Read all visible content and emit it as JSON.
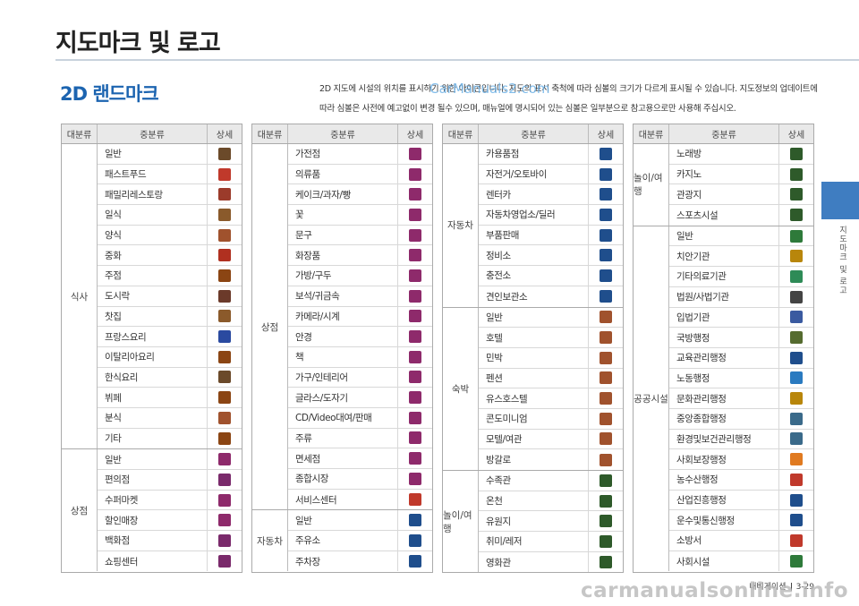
{
  "page_title": "지도마크 및 로고",
  "section_title": "2D 랜드마크",
  "intro": "2D 지도에 시설의 위치를 표시하기 위한 아이콘입니다. 지도의 표시 축척에 따라 심볼의 크기가 다르게 표시될 수 있습니다. 지도정보의 업데이트에 따라 심볼은 사전에 예고없이 변경 될수 있으며, 매뉴얼에 명시되어 있는 심볼은 일부분으로 참고용으로만 사용해 주십시오.",
  "watermark_top": "CarManuals2.com",
  "watermark_bottom": "carmanualsonline.info",
  "side_label": "지도마크 및 로고",
  "footer": {
    "left": "내비게이션",
    "right": "3-29"
  },
  "header": {
    "cat": "대분류",
    "sub": "중분류",
    "detail": "상세"
  },
  "tables": [
    {
      "groups": [
        {
          "name": "식사",
          "items": [
            {
              "label": "일반",
              "icon": "fork-knife-icon",
              "color": "#6b4a2a"
            },
            {
              "label": "패스트푸드",
              "icon": "fastfood-icon",
              "color": "#c0392b"
            },
            {
              "label": "패밀리레스토랑",
              "icon": "family-restaurant-icon",
              "color": "#9b3b2b"
            },
            {
              "label": "일식",
              "icon": "chopsticks-icon",
              "color": "#8a5a2b"
            },
            {
              "label": "양식",
              "icon": "plate-icon",
              "color": "#a0522d"
            },
            {
              "label": "중화",
              "icon": "chinese-icon",
              "color": "#b03020"
            },
            {
              "label": "주점",
              "icon": "beer-icon",
              "color": "#8b4513"
            },
            {
              "label": "도시락",
              "icon": "lunchbox-icon",
              "color": "#6b3a2a"
            },
            {
              "label": "찻집",
              "icon": "teacup-icon",
              "color": "#8b5a2b"
            },
            {
              "label": "프랑스요리",
              "icon": "france-flag-icon",
              "color": "#2a4aa0"
            },
            {
              "label": "이탈리아요리",
              "icon": "italy-icon",
              "color": "#8b4513"
            },
            {
              "label": "한식요리",
              "icon": "spoon-chopsticks-icon",
              "color": "#6b4a2a"
            },
            {
              "label": "뷔페",
              "icon": "buffet-icon",
              "color": "#8b4513"
            },
            {
              "label": "분식",
              "icon": "snack-icon",
              "color": "#a0522d"
            },
            {
              "label": "기타",
              "icon": "other-food-icon",
              "color": "#8b4513"
            }
          ]
        },
        {
          "name": "상점",
          "items": [
            {
              "label": "일반",
              "icon": "gift-icon",
              "color": "#8e2a6b"
            },
            {
              "label": "편의점",
              "icon": "convenience-store-icon",
              "color": "#7a2a6b"
            },
            {
              "label": "수퍼마켓",
              "icon": "basket-icon",
              "color": "#8e2a6b"
            },
            {
              "label": "할인매장",
              "icon": "sale-cart-icon",
              "color": "#8e2a6b"
            },
            {
              "label": "백화점",
              "icon": "department-store-icon",
              "color": "#7a2a6b"
            },
            {
              "label": "쇼핑센터",
              "icon": "shopping-center-icon",
              "color": "#7a2a6b"
            }
          ]
        }
      ]
    },
    {
      "groups": [
        {
          "name": "상점",
          "items": [
            {
              "label": "가전점",
              "icon": "tv-icon",
              "color": "#8e2a6b"
            },
            {
              "label": "의류품",
              "icon": "shirt-icon",
              "color": "#8e2a6b"
            },
            {
              "label": "케이크/과자/빵",
              "icon": "bread-icon",
              "color": "#8e2a6b"
            },
            {
              "label": "꽃",
              "icon": "flower-icon",
              "color": "#8e2a6b"
            },
            {
              "label": "문구",
              "icon": "stationery-icon",
              "color": "#8e2a6b"
            },
            {
              "label": "화장품",
              "icon": "cosmetics-icon",
              "color": "#8e2a6b"
            },
            {
              "label": "가방/구두",
              "icon": "bag-icon",
              "color": "#8e2a6b"
            },
            {
              "label": "보석/귀금속",
              "icon": "diamond-icon",
              "color": "#8e2a6b"
            },
            {
              "label": "카메라/시계",
              "icon": "camera-icon",
              "color": "#8e2a6b"
            },
            {
              "label": "안경",
              "icon": "glasses-icon",
              "color": "#8e2a6b"
            },
            {
              "label": "책",
              "icon": "book-icon",
              "color": "#8e2a6b"
            },
            {
              "label": "가구/인테리어",
              "icon": "lamp-icon",
              "color": "#8e2a6b"
            },
            {
              "label": "글라스/도자기",
              "icon": "vase-icon",
              "color": "#8e2a6b"
            },
            {
              "label": "CD/Video대여/판매",
              "icon": "disc-icon",
              "color": "#8e2a6b"
            },
            {
              "label": "주류",
              "icon": "bottles-icon",
              "color": "#8e2a6b"
            },
            {
              "label": "면세점",
              "icon": "duty-free-icon",
              "color": "#8e2a6b"
            },
            {
              "label": "종합시장",
              "icon": "market-icon",
              "color": "#8e2a6b"
            },
            {
              "label": "서비스센터",
              "icon": "service-center-icon",
              "color": "#c0392b"
            }
          ]
        },
        {
          "name": "자동차",
          "items": [
            {
              "label": "일반",
              "icon": "car-icon",
              "color": "#1f4e8c"
            },
            {
              "label": "주유소",
              "icon": "gas-station-icon",
              "color": "#1f4e8c"
            },
            {
              "label": "주차장",
              "icon": "parking-icon",
              "color": "#1f4e8c"
            }
          ]
        }
      ]
    },
    {
      "groups": [
        {
          "name": "자동차",
          "items": [
            {
              "label": "카용품점",
              "icon": "tire-icon",
              "color": "#1f4e8c"
            },
            {
              "label": "자전거/오토바이",
              "icon": "bicycle-icon",
              "color": "#1f4e8c"
            },
            {
              "label": "렌터카",
              "icon": "rental-car-icon",
              "color": "#1f4e8c"
            },
            {
              "label": "자동차영업소/딜러",
              "icon": "car-shop-icon",
              "color": "#1f4e8c"
            },
            {
              "label": "부품판매",
              "icon": "parts-icon",
              "color": "#1f4e8c"
            },
            {
              "label": "정비소",
              "icon": "repair-icon",
              "color": "#1f4e8c"
            },
            {
              "label": "충전소",
              "icon": "charging-icon",
              "color": "#1f4e8c"
            },
            {
              "label": "견인보관소",
              "icon": "tow-icon",
              "color": "#1f4e8c"
            }
          ]
        },
        {
          "name": "숙박",
          "items": [
            {
              "label": "일반",
              "icon": "hotel-general-icon",
              "color": "#a0522d"
            },
            {
              "label": "호텔",
              "icon": "hotel-icon",
              "color": "#a0522d"
            },
            {
              "label": "민박",
              "icon": "guesthouse-icon",
              "color": "#a0522d"
            },
            {
              "label": "펜션",
              "icon": "pension-icon",
              "color": "#a0522d"
            },
            {
              "label": "유스호스텔",
              "icon": "hostel-icon",
              "color": "#a0522d"
            },
            {
              "label": "콘도미니엄",
              "icon": "condo-icon",
              "color": "#a0522d"
            },
            {
              "label": "모텔/여관",
              "icon": "motel-icon",
              "color": "#a0522d"
            },
            {
              "label": "방갈로",
              "icon": "bungalow-icon",
              "color": "#a0522d"
            }
          ]
        },
        {
          "name": "놀이/여행",
          "items": [
            {
              "label": "수족관",
              "icon": "fish-icon",
              "color": "#2e5a2a"
            },
            {
              "label": "온천",
              "icon": "hot-spring-icon",
              "color": "#2e5a2a"
            },
            {
              "label": "유원지",
              "icon": "amusement-icon",
              "color": "#2e5a2a"
            },
            {
              "label": "취미/레저",
              "icon": "leisure-icon",
              "color": "#2e5a2a"
            },
            {
              "label": "영화관",
              "icon": "cinema-icon",
              "color": "#2e5a2a"
            }
          ]
        }
      ]
    },
    {
      "groups": [
        {
          "name": "놀이/여행",
          "items": [
            {
              "label": "노래방",
              "icon": "karaoke-icon",
              "color": "#2e5a2a"
            },
            {
              "label": "카지노",
              "icon": "casino-icon",
              "color": "#2e5a2a"
            },
            {
              "label": "관광지",
              "icon": "tourist-icon",
              "color": "#2e5a2a"
            },
            {
              "label": "스포츠시설",
              "icon": "sports-icon",
              "color": "#2e5a2a"
            }
          ]
        },
        {
          "name": "공공시설",
          "items": [
            {
              "label": "일반",
              "icon": "public-building-icon",
              "color": "#2e7a3a"
            },
            {
              "label": "치안기관",
              "icon": "police-icon",
              "color": "#b8860b"
            },
            {
              "label": "기타의료기관",
              "icon": "medical-icon",
              "color": "#2e8b57"
            },
            {
              "label": "법원/사법기관",
              "icon": "scales-icon",
              "color": "#444444"
            },
            {
              "label": "입법기관",
              "icon": "assembly-icon",
              "color": "#3a5aa0"
            },
            {
              "label": "국방행정",
              "icon": "defense-icon",
              "color": "#556b2f"
            },
            {
              "label": "교육관리행정",
              "icon": "education-icon",
              "color": "#1f4e8c"
            },
            {
              "label": "노동행정",
              "icon": "labor-icon",
              "color": "#2a7ac0"
            },
            {
              "label": "문화관리행정",
              "icon": "culture-icon",
              "color": "#b8860b"
            },
            {
              "label": "중앙종합행정",
              "icon": "central-admin-icon",
              "color": "#3a6a8a"
            },
            {
              "label": "환경및보건관리행정",
              "icon": "environment-icon",
              "color": "#3a6a8a"
            },
            {
              "label": "사회보장행정",
              "icon": "welfare-icon",
              "color": "#e07a20"
            },
            {
              "label": "농수산행정",
              "icon": "agriculture-icon",
              "color": "#c0392b"
            },
            {
              "label": "산업진흥행정",
              "icon": "industry-icon",
              "color": "#1f4e8c"
            },
            {
              "label": "운수및통신행정",
              "icon": "transport-icon",
              "color": "#1f4e8c"
            },
            {
              "label": "소방서",
              "icon": "fire-station-icon",
              "color": "#c0392b"
            },
            {
              "label": "사회시설",
              "icon": "social-facility-icon",
              "color": "#2e7a3a"
            }
          ]
        }
      ]
    }
  ]
}
